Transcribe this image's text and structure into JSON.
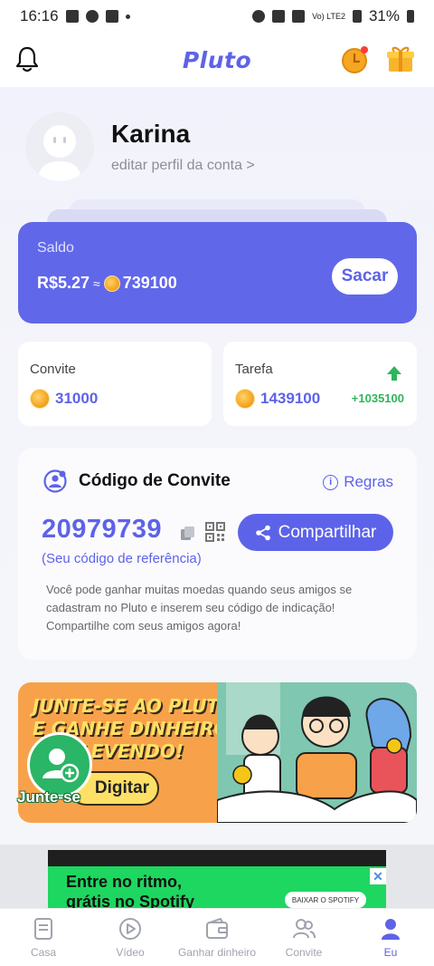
{
  "status_bar": {
    "time": "16:16",
    "network": "Vo) LTE2",
    "battery": "31%"
  },
  "header": {
    "logo": "Pluto"
  },
  "profile": {
    "name": "Karina",
    "edit_link": "editar perfil da conta >"
  },
  "balance": {
    "label": "Saldo",
    "currency_value": "R$5.27",
    "approx": "≈",
    "coins": "739100",
    "withdraw_label": "Sacar"
  },
  "stats": {
    "invite_label": "Convite",
    "invite_coins": "31000",
    "task_label": "Tarefa",
    "task_coins": "1439100",
    "task_delta": "+1035100"
  },
  "invite_code": {
    "title": "Código de Convite",
    "rules_label": "Regras",
    "code": "20979739",
    "share_label": "Compartilhar",
    "code_note": "(Seu código de referência)",
    "description": "Você pode ganhar muitas moedas quando seus amigos se cadastram no Pluto e inserem seu código de indicação! Compartilhe com seus amigos agora!"
  },
  "banner": {
    "headline_line1": "JUNTE-SE AO PLUTOR",
    "headline_line2": "E GANHE DINHEIRO",
    "headline_line3": "LEVENDO!",
    "button_label": "Digitar",
    "join_label": "Junte-se"
  },
  "ad": {
    "text_line1": "Entre no ritmo,",
    "text_line2": "grátis no Spotify",
    "cta": "BAIXAR O SPOTIFY",
    "close": "✕"
  },
  "tabs": [
    {
      "label": "Casa",
      "icon": "book-icon"
    },
    {
      "label": "Vídeo",
      "icon": "play-icon"
    },
    {
      "label": "Ganhar dinheiro",
      "icon": "wallet-icon"
    },
    {
      "label": "Convite",
      "icon": "users-icon"
    },
    {
      "label": "Eu",
      "icon": "person-icon"
    }
  ],
  "colors": {
    "accent": "#5d63e8",
    "positive": "#2fb55a",
    "banner": "#f7a24a"
  }
}
